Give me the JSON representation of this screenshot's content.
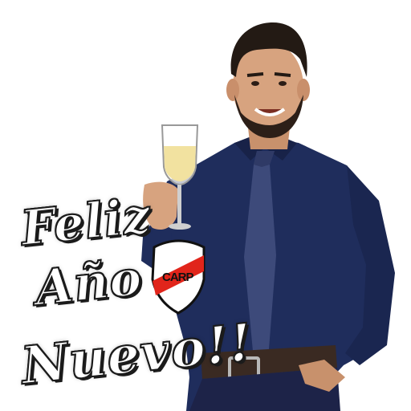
{
  "sticker": {
    "greeting": {
      "line1": "Feliz",
      "line2": "Año",
      "line3": "Nuevo!!"
    },
    "crest": {
      "monogram": "CARP",
      "colors": {
        "red": "#e1251b",
        "white": "#ffffff",
        "outline": "#111111"
      }
    },
    "palette": {
      "shirt": "#1f2d5c",
      "tie": "#3d4a7a",
      "hair": "#231a14",
      "skin": "#d7a37f",
      "belt": "#3a2a22",
      "champagne": "#f2e2a0"
    }
  }
}
